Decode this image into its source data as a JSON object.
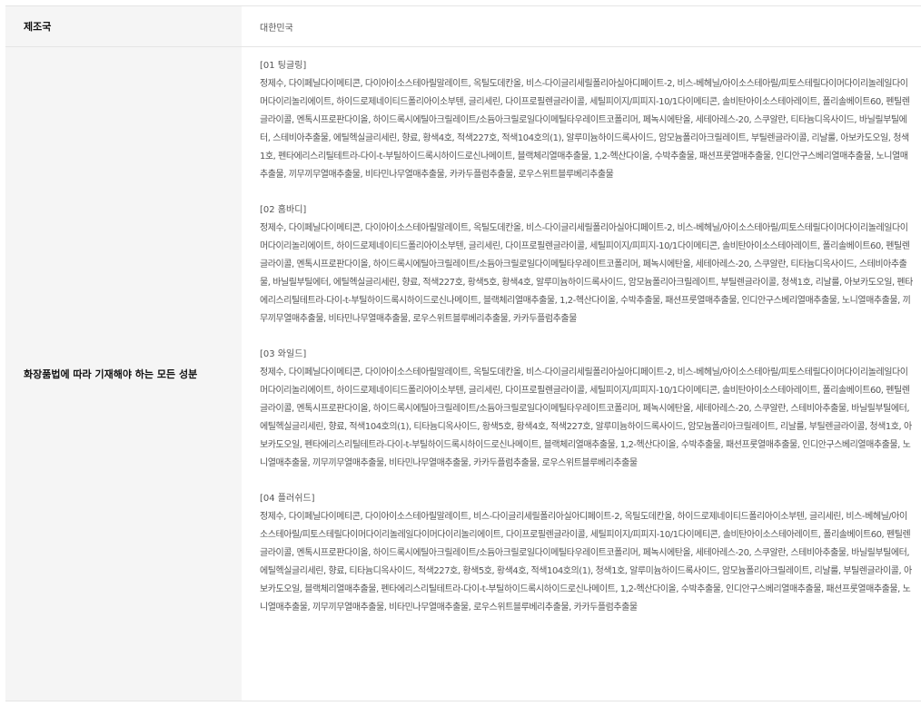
{
  "rows": [
    {
      "label": "제조국",
      "value": "대한민국"
    },
    {
      "label": "화장품법에 따라 기재해야 하는 모든 성분",
      "sections": [
        {
          "title": "[01 팅글링]",
          "body": "정제수, 다이페닐다이메티콘, 다이아이소스테아릴말레이트, 옥틸도데칸올, 비스-다이글리세릴폴리아실아디페이트-2, 비스-베헤닐/아이소스테아릴/피토스테릴다이머다이리놀레일다이머다이리놀리에이트, 하이드로제네이티드폴리아이소부텐, 글리세린, 다이프로필렌글라이콜, 세틸피이지/피피지-10/1다이메티콘, 솔비탄아이소스테아레이트, 폴리솔베이트60, 펜틸렌글라이콜, 멘톡시프로판다이올, 하이드록시에틸아크릴레이트/소듐아크릴로일다이메틸타우레이트코폴리머, 페녹시에탄올, 세테아레스-20, 스쿠알란, 티타늄디옥사이드, 바닐릴부틸에터, 스테비아추출물, 에틸헥실글리세린, 향료, 황색4호, 적색227호, 적색104호의(1), 알루미늄하이드록사이드, 암모늄폴리아크릴레이트, 부틸렌글라이콜, 리날룰, 아보카도오일, 청색1호, 펜타에리스리틸테트라-다이-t-부틸하이드록시하이드로신나메이트, 블랙체리열매추출물, 1,2-헥산다이올, 수박추출물, 패션프룻열매추출물, 인디안구스베리열매추출물, 노니열매추출물, 끼무끼무열매추출물, 비타민나무열매추출물, 카카두플럼추출물, 로우스위트블루베리추출물"
        },
        {
          "title": "[02 홈바디]",
          "body": "정제수, 다이페닐다이메티콘, 다이아이소스테아릴말레이트, 옥틸도데칸올, 비스-다이글리세릴폴리아실아디페이트-2, 비스-베헤닐/아이소스테아릴/피토스테릴다이머다이리놀레일다이머다이리놀리에이트, 하이드로제네이티드폴리아이소부텐, 글리세린, 다이프로필렌글라이콜, 세틸피이지/피피지-10/1다이메티콘, 솔비탄아이소스테아레이트, 폴리솔베이트60, 펜틸렌글라이콜, 멘톡시프로판다이올, 하이드록시에틸아크릴레이트/소듐아크릴로일다이메틸타우레이트코폴리머, 페녹시에탄올, 세테아레스-20, 스쿠알란, 티타늄디옥사이드, 스테비아추출물, 바닐릴부틸에터, 에틸헥실글리세린, 향료, 적색227호, 황색5호, 황색4호, 알루미늄하이드록사이드, 암모늄폴리아크릴레이트, 부틸렌글라이콜, 청색1호, 리날룰, 아보카도오일, 펜타에리스리틸테트라-다이-t-부틸하이드록시하이드로신나메이트, 블랙체리열매추출물, 1,2-헥산다이올, 수박추출물, 패션프룻열매추출물, 인디안구스베리열매추출물, 노니열매추출물, 끼무끼무열매추출물, 비타민나무열매추출물, 로우스위트블루베리추출물, 카카두플럼추출물"
        },
        {
          "title": "[03 와일드]",
          "body": "정제수, 다이페닐다이메티콘, 다이아이소스테아릴말레이트, 옥틸도데칸올, 비스-다이글리세릴폴리아실아디페이트-2, 비스-베헤닐/아이소스테아릴/피토스테릴다이머다이리놀레일다이머다이리놀리에이트, 하이드로제네이티드폴리아이소부텐, 글리세린, 다이프로필렌글라이콜, 세틸피이지/피피지-10/1다이메티콘, 솔비탄아이소스테아레이트, 폴리솔베이트60, 펜틸렌글라이콜, 멘톡시프로판다이올, 하이드록시에틸아크릴레이트/소듐아크릴로일다이메틸타우레이트코폴리머, 페녹시에탄올, 세테아레스-20, 스쿠알란, 스테비아추출물, 바닐릴부틸에터, 에틸헥실글리세린, 향료, 적색104호의(1), 티타늄디옥사이드, 황색5호, 황색4호, 적색227호, 알루미늄하이드록사이드, 암모늄폴리아크릴레이트, 리날룰, 부틸렌글라이콜, 청색1호, 아보카도오일, 펜타에리스리틸테트라-다이-t-부틸하이드록시하이드로신나메이트, 블랙체리열매추출물, 1,2-헥산다이올, 수박추출물, 패션프룻열매추출물, 인디안구스베리열매추출물, 노니열매추출물, 끼무끼무열매추출물, 비타민나무열매추출물, 카카두플럼추출물, 로우스위트블루베리추출물"
        },
        {
          "title": "[04 플러쉬드]",
          "body": "정제수, 다이페닐다이메티콘, 다이아이소스테아릴말레이트, 비스-다이글리세릴폴리아실아디페이트-2, 옥틸도데칸올, 하이드로제네이티드폴리아이소부텐, 글리세린, 비스-베헤닐/아이소스테아릴/피토스테릴다이머다이리놀레일다이머다이리놀리에이트, 다이프로필렌글라이콜, 세틸피이지/피피지-10/1다이메티콘, 솔비탄아이소스테아레이트, 폴리솔베이트60, 펜틸렌글라이콜, 멘톡시프로판다이올, 하이드록시에틸아크릴레이트/소듐아크릴로일다이메틸타우레이트코폴리머, 페녹시에탄올, 세테아레스-20, 스쿠알란, 스테비아추출물, 바닐릴부틸에터, 에틸헥실글리세린, 향료, 티타늄디옥사이드, 적색227호, 황색5호, 황색4호, 적색104호의(1), 청색1호, 알루미늄하이드록사이드, 암모늄폴리아크릴레이트, 리날룰, 부틸렌글라이콜, 아보카도오일, 블랙체리열매추출물, 펜타에리스리틸테트라-다이-t-부틸하이드록시하이드로신나메이트, 1,2-헥산다이올, 수박추출물, 인디안구스베리열매추출물, 패션프룻열매추출물, 노니열매추출물, 끼무끼무열매추출물, 비타민나무열매추출물, 로우스위트블루베리추출물, 카카두플럼추출물"
        }
      ]
    }
  ]
}
